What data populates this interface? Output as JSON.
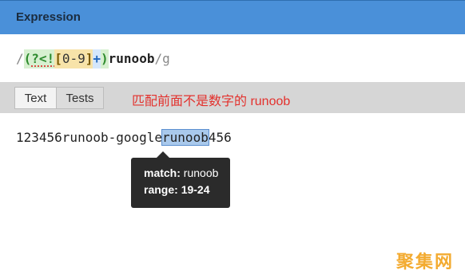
{
  "header": {
    "title": "Expression"
  },
  "expression": {
    "delimiter_open": "/",
    "group_open": "(",
    "lookbehind": "?<!",
    "class_open": "[",
    "class_body": "0-9",
    "class_close": "]",
    "quantifier": "+",
    "group_close": ")",
    "literal": "runoob",
    "delimiter_close": "/",
    "flags": "g"
  },
  "tabs": [
    {
      "label": "Text"
    },
    {
      "label": "Tests"
    }
  ],
  "annotation": "匹配前面不是数字的 runoob",
  "sample": {
    "before": "123456runoob-google",
    "match": "runoob",
    "after": "456"
  },
  "tooltip": {
    "match_key": "match:",
    "match_value": "runoob",
    "range_key": "range:",
    "range_value": "19-24"
  },
  "watermark": "聚集网",
  "colors": {
    "header_bg": "#4a90d9",
    "annotation": "#e3312d",
    "match_highlight": "#a9c9ec",
    "tooltip_bg": "#2b2b2b"
  }
}
